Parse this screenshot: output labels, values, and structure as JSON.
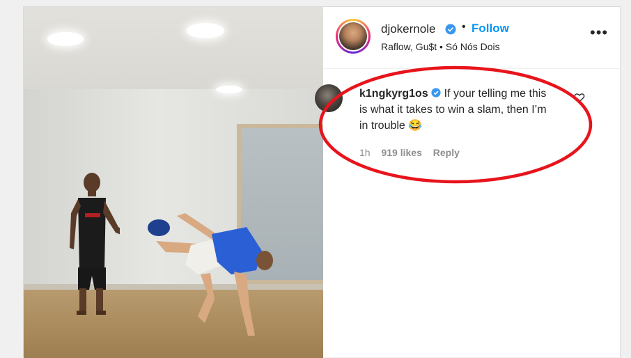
{
  "post": {
    "username": "djokernole",
    "separator": "•",
    "follow_label": "Follow",
    "audio": "Raflow, Gu$t • Só Nós Dois",
    "more_label": "•••"
  },
  "comment": {
    "username": "k1ngkyrg1os",
    "text": "If your telling me this is what it takes to win a slam, then I’m in trouble 😂",
    "time": "1h",
    "likes": "919 likes",
    "reply_label": "Reply"
  },
  "colors": {
    "follow": "#0095f6",
    "verified": "#3897f0",
    "annotation": "#e8141c",
    "text": "#262626",
    "meta": "#8e8e8e"
  },
  "icons": [
    "verified-badge-icon",
    "more-options-icon",
    "heart-icon"
  ]
}
